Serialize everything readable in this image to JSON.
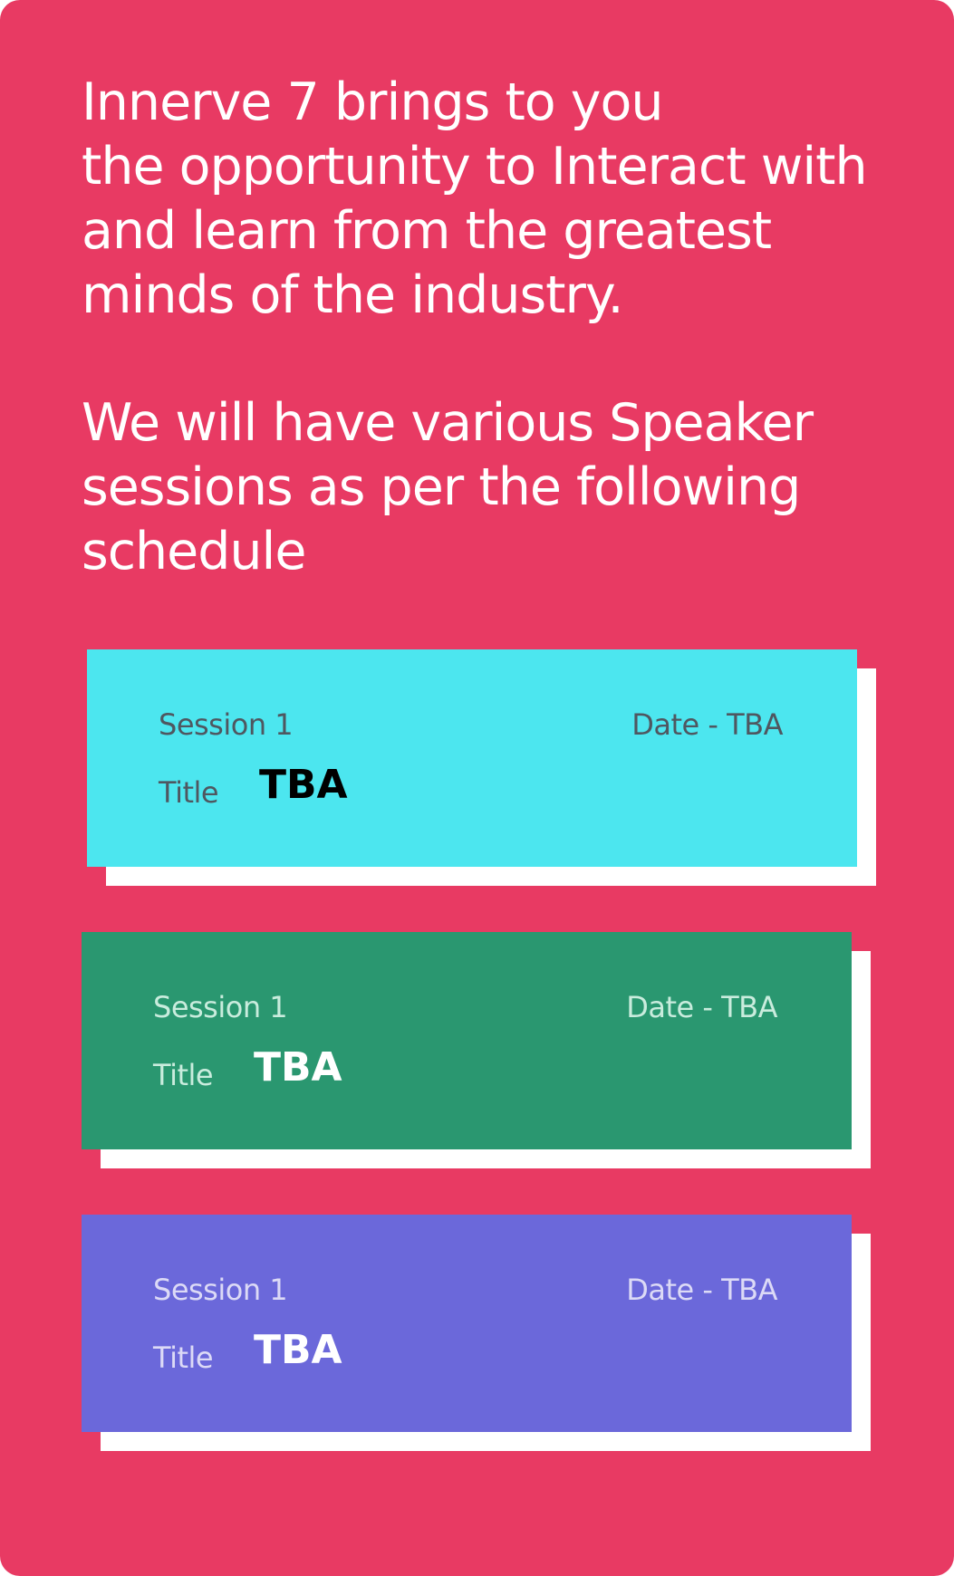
{
  "colors": {
    "background": "#E83A63",
    "card_shadow": "#FFFFFF"
  },
  "intro": {
    "paragraph1": "Innerve 7 brings to you\nthe opportunity to Interact with\nand learn from the greatest\nminds of the industry.",
    "paragraph2": "We will have various Speaker\nsessions as per the following\nschedule"
  },
  "sessions": [
    {
      "session_label": "Session 1",
      "date_label": "Date - TBA",
      "title_label": "Title",
      "title_value": "TBA",
      "card_color": "#4CE6EF",
      "muted_text_color": "#4F5760",
      "value_text_color": "#000000"
    },
    {
      "session_label": "Session 1",
      "date_label": "Date - TBA",
      "title_label": "Title",
      "title_value": "TBA",
      "card_color": "#2A9770",
      "muted_text_color": "#C9ECDD",
      "value_text_color": "#FFFFFF"
    },
    {
      "session_label": "Session 1",
      "date_label": "Date - TBA",
      "title_label": "Title",
      "title_value": "TBA",
      "card_color": "#6B68DA",
      "muted_text_color": "#DCDAF6",
      "value_text_color": "#FFFFFF"
    }
  ]
}
